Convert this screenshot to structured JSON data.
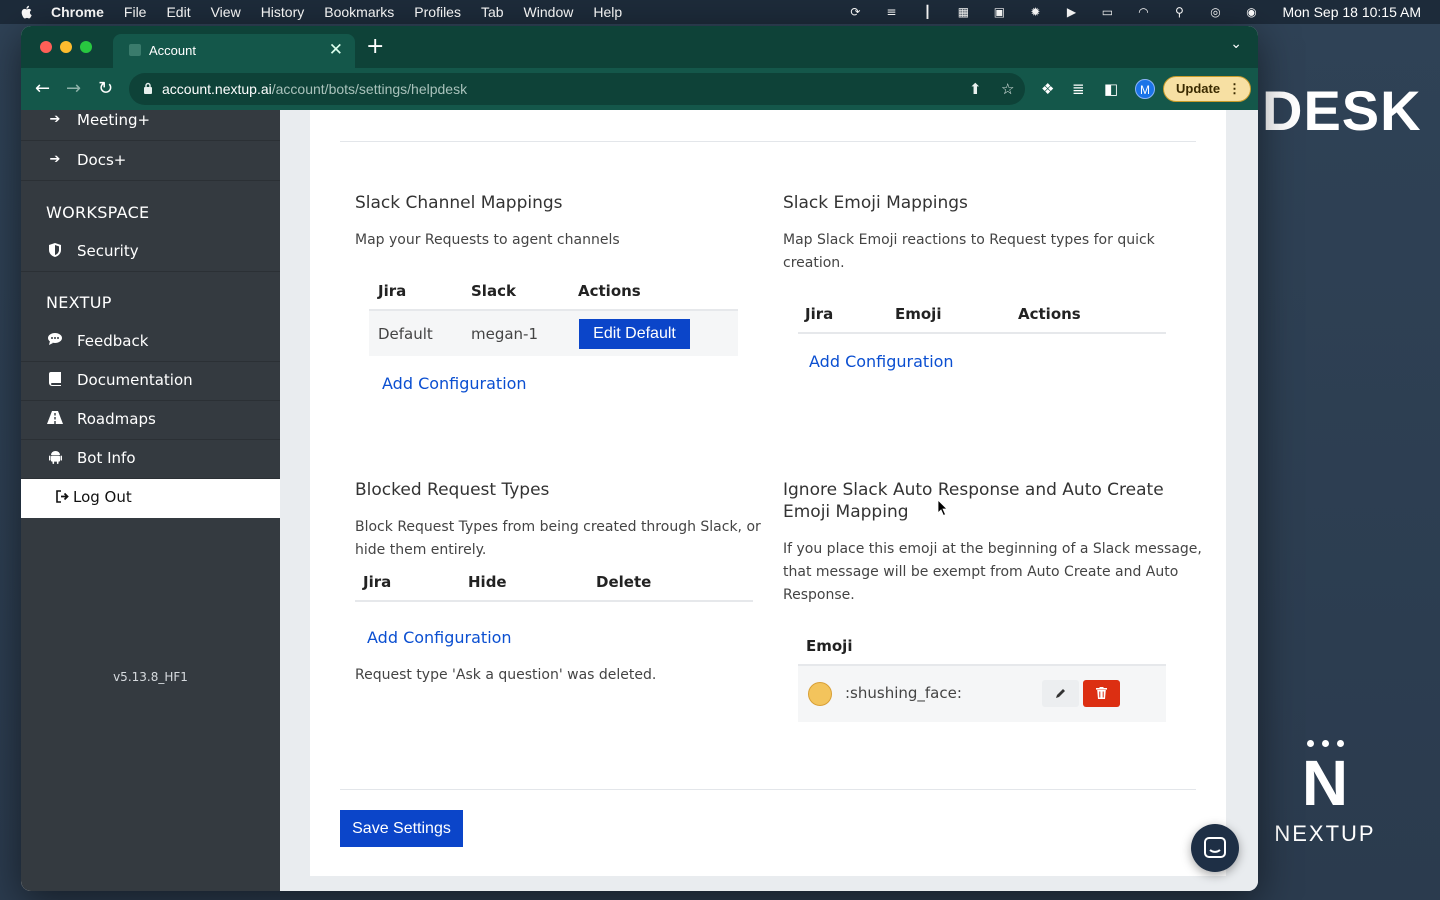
{
  "menubar": {
    "app": "Chrome",
    "items": [
      "File",
      "Edit",
      "View",
      "History",
      "Bookmarks",
      "Profiles",
      "Tab",
      "Window",
      "Help"
    ],
    "clock": "Mon Sep 18  10:15 AM"
  },
  "browser": {
    "tab_title": "Account",
    "url_host": "account.nextup.ai",
    "url_path": "/account/bots/settings/helpdesk",
    "avatar_letter": "M",
    "update_label": "Update"
  },
  "wallpaper": {
    "desk_text": "DESK",
    "logo_letter": "N",
    "logo_name": "NEXTUP"
  },
  "sidebar": {
    "top_items": [
      {
        "label": "Meeting+",
        "icon": "arrow-right-icon"
      },
      {
        "label": "Docs+",
        "icon": "arrow-right-icon"
      }
    ],
    "workspace_heading": "WORKSPACE",
    "workspace_items": [
      {
        "label": "Security",
        "icon": "shield-icon"
      }
    ],
    "nextup_heading": "NEXTUP",
    "nextup_items": [
      {
        "label": "Feedback",
        "icon": "chat-icon"
      },
      {
        "label": "Documentation",
        "icon": "book-icon"
      },
      {
        "label": "Roadmaps",
        "icon": "road-icon"
      },
      {
        "label": "Bot Info",
        "icon": "android-icon"
      }
    ],
    "logout_label": "Log Out",
    "version": "v5.13.8_HF1"
  },
  "channel_mappings": {
    "title": "Slack Channel Mappings",
    "description": "Map your Requests to agent channels",
    "headers": [
      "Jira",
      "Slack",
      "Actions"
    ],
    "rows": [
      {
        "jira": "Default",
        "slack": "megan-1",
        "action": "Edit Default"
      }
    ],
    "add_link": "Add Configuration"
  },
  "emoji_mappings": {
    "title": "Slack Emoji Mappings",
    "description_line1": "Map Slack Emoji reactions to Request types for quick",
    "description_line2": "creation.",
    "headers": [
      "Jira",
      "Emoji",
      "Actions"
    ],
    "add_link": "Add Configuration"
  },
  "blocked_types": {
    "title": "Blocked Request Types",
    "description_line1": "Block Request Types from being created through Slack, or",
    "description_line2": "hide them entirely.",
    "headers": [
      "Jira",
      "Hide",
      "Delete"
    ],
    "add_link": "Add Configuration",
    "notice": "Request type 'Ask a question' was deleted."
  },
  "ignore_emoji": {
    "title_line1": "Ignore Slack Auto Response and Auto Create",
    "title_line2": "Emoji Mapping",
    "description_line1": "If you place this emoji at the beginning of a Slack message,",
    "description_line2": "that message will be exempt from Auto Create and Auto",
    "description_line3": "Response.",
    "header": "Emoji",
    "emoji_code": ":shushing_face:"
  },
  "save_label": "Save Settings",
  "colors": {
    "primary": "#0b45c9",
    "danger": "#dc2f12",
    "sidebar_bg": "#343a40",
    "browser_frame": "#14574a"
  }
}
